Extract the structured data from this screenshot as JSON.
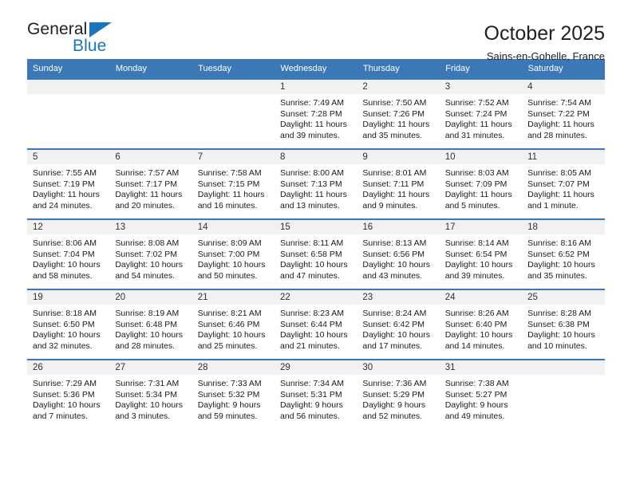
{
  "logo": {
    "word_top": "General",
    "word_bottom": "Blue",
    "accent_color": "#1b75bb",
    "triangle_icon": "triangle-icon"
  },
  "header": {
    "title": "October 2025",
    "subtitle": "Sains-en-Gohelle, France"
  },
  "calendar": {
    "header_color": "#3b78b5",
    "weekday_headers": [
      "Sunday",
      "Monday",
      "Tuesday",
      "Wednesday",
      "Thursday",
      "Friday",
      "Saturday"
    ],
    "weeks": [
      [
        {
          "day": "",
          "blank": true
        },
        {
          "day": "",
          "blank": true
        },
        {
          "day": "",
          "blank": true
        },
        {
          "day": "1",
          "sunrise": "Sunrise: 7:49 AM",
          "sunset": "Sunset: 7:28 PM",
          "daylight1": "Daylight: 11 hours",
          "daylight2": "and 39 minutes."
        },
        {
          "day": "2",
          "sunrise": "Sunrise: 7:50 AM",
          "sunset": "Sunset: 7:26 PM",
          "daylight1": "Daylight: 11 hours",
          "daylight2": "and 35 minutes."
        },
        {
          "day": "3",
          "sunrise": "Sunrise: 7:52 AM",
          "sunset": "Sunset: 7:24 PM",
          "daylight1": "Daylight: 11 hours",
          "daylight2": "and 31 minutes."
        },
        {
          "day": "4",
          "sunrise": "Sunrise: 7:54 AM",
          "sunset": "Sunset: 7:22 PM",
          "daylight1": "Daylight: 11 hours",
          "daylight2": "and 28 minutes."
        }
      ],
      [
        {
          "day": "5",
          "sunrise": "Sunrise: 7:55 AM",
          "sunset": "Sunset: 7:19 PM",
          "daylight1": "Daylight: 11 hours",
          "daylight2": "and 24 minutes."
        },
        {
          "day": "6",
          "sunrise": "Sunrise: 7:57 AM",
          "sunset": "Sunset: 7:17 PM",
          "daylight1": "Daylight: 11 hours",
          "daylight2": "and 20 minutes."
        },
        {
          "day": "7",
          "sunrise": "Sunrise: 7:58 AM",
          "sunset": "Sunset: 7:15 PM",
          "daylight1": "Daylight: 11 hours",
          "daylight2": "and 16 minutes."
        },
        {
          "day": "8",
          "sunrise": "Sunrise: 8:00 AM",
          "sunset": "Sunset: 7:13 PM",
          "daylight1": "Daylight: 11 hours",
          "daylight2": "and 13 minutes."
        },
        {
          "day": "9",
          "sunrise": "Sunrise: 8:01 AM",
          "sunset": "Sunset: 7:11 PM",
          "daylight1": "Daylight: 11 hours",
          "daylight2": "and 9 minutes."
        },
        {
          "day": "10",
          "sunrise": "Sunrise: 8:03 AM",
          "sunset": "Sunset: 7:09 PM",
          "daylight1": "Daylight: 11 hours",
          "daylight2": "and 5 minutes."
        },
        {
          "day": "11",
          "sunrise": "Sunrise: 8:05 AM",
          "sunset": "Sunset: 7:07 PM",
          "daylight1": "Daylight: 11 hours",
          "daylight2": "and 1 minute."
        }
      ],
      [
        {
          "day": "12",
          "sunrise": "Sunrise: 8:06 AM",
          "sunset": "Sunset: 7:04 PM",
          "daylight1": "Daylight: 10 hours",
          "daylight2": "and 58 minutes."
        },
        {
          "day": "13",
          "sunrise": "Sunrise: 8:08 AM",
          "sunset": "Sunset: 7:02 PM",
          "daylight1": "Daylight: 10 hours",
          "daylight2": "and 54 minutes."
        },
        {
          "day": "14",
          "sunrise": "Sunrise: 8:09 AM",
          "sunset": "Sunset: 7:00 PM",
          "daylight1": "Daylight: 10 hours",
          "daylight2": "and 50 minutes."
        },
        {
          "day": "15",
          "sunrise": "Sunrise: 8:11 AM",
          "sunset": "Sunset: 6:58 PM",
          "daylight1": "Daylight: 10 hours",
          "daylight2": "and 47 minutes."
        },
        {
          "day": "16",
          "sunrise": "Sunrise: 8:13 AM",
          "sunset": "Sunset: 6:56 PM",
          "daylight1": "Daylight: 10 hours",
          "daylight2": "and 43 minutes."
        },
        {
          "day": "17",
          "sunrise": "Sunrise: 8:14 AM",
          "sunset": "Sunset: 6:54 PM",
          "daylight1": "Daylight: 10 hours",
          "daylight2": "and 39 minutes."
        },
        {
          "day": "18",
          "sunrise": "Sunrise: 8:16 AM",
          "sunset": "Sunset: 6:52 PM",
          "daylight1": "Daylight: 10 hours",
          "daylight2": "and 35 minutes."
        }
      ],
      [
        {
          "day": "19",
          "sunrise": "Sunrise: 8:18 AM",
          "sunset": "Sunset: 6:50 PM",
          "daylight1": "Daylight: 10 hours",
          "daylight2": "and 32 minutes."
        },
        {
          "day": "20",
          "sunrise": "Sunrise: 8:19 AM",
          "sunset": "Sunset: 6:48 PM",
          "daylight1": "Daylight: 10 hours",
          "daylight2": "and 28 minutes."
        },
        {
          "day": "21",
          "sunrise": "Sunrise: 8:21 AM",
          "sunset": "Sunset: 6:46 PM",
          "daylight1": "Daylight: 10 hours",
          "daylight2": "and 25 minutes."
        },
        {
          "day": "22",
          "sunrise": "Sunrise: 8:23 AM",
          "sunset": "Sunset: 6:44 PM",
          "daylight1": "Daylight: 10 hours",
          "daylight2": "and 21 minutes."
        },
        {
          "day": "23",
          "sunrise": "Sunrise: 8:24 AM",
          "sunset": "Sunset: 6:42 PM",
          "daylight1": "Daylight: 10 hours",
          "daylight2": "and 17 minutes."
        },
        {
          "day": "24",
          "sunrise": "Sunrise: 8:26 AM",
          "sunset": "Sunset: 6:40 PM",
          "daylight1": "Daylight: 10 hours",
          "daylight2": "and 14 minutes."
        },
        {
          "day": "25",
          "sunrise": "Sunrise: 8:28 AM",
          "sunset": "Sunset: 6:38 PM",
          "daylight1": "Daylight: 10 hours",
          "daylight2": "and 10 minutes."
        }
      ],
      [
        {
          "day": "26",
          "sunrise": "Sunrise: 7:29 AM",
          "sunset": "Sunset: 5:36 PM",
          "daylight1": "Daylight: 10 hours",
          "daylight2": "and 7 minutes."
        },
        {
          "day": "27",
          "sunrise": "Sunrise: 7:31 AM",
          "sunset": "Sunset: 5:34 PM",
          "daylight1": "Daylight: 10 hours",
          "daylight2": "and 3 minutes."
        },
        {
          "day": "28",
          "sunrise": "Sunrise: 7:33 AM",
          "sunset": "Sunset: 5:32 PM",
          "daylight1": "Daylight: 9 hours",
          "daylight2": "and 59 minutes."
        },
        {
          "day": "29",
          "sunrise": "Sunrise: 7:34 AM",
          "sunset": "Sunset: 5:31 PM",
          "daylight1": "Daylight: 9 hours",
          "daylight2": "and 56 minutes."
        },
        {
          "day": "30",
          "sunrise": "Sunrise: 7:36 AM",
          "sunset": "Sunset: 5:29 PM",
          "daylight1": "Daylight: 9 hours",
          "daylight2": "and 52 minutes."
        },
        {
          "day": "31",
          "sunrise": "Sunrise: 7:38 AM",
          "sunset": "Sunset: 5:27 PM",
          "daylight1": "Daylight: 9 hours",
          "daylight2": "and 49 minutes."
        },
        {
          "day": "",
          "blank": true
        }
      ]
    ]
  }
}
